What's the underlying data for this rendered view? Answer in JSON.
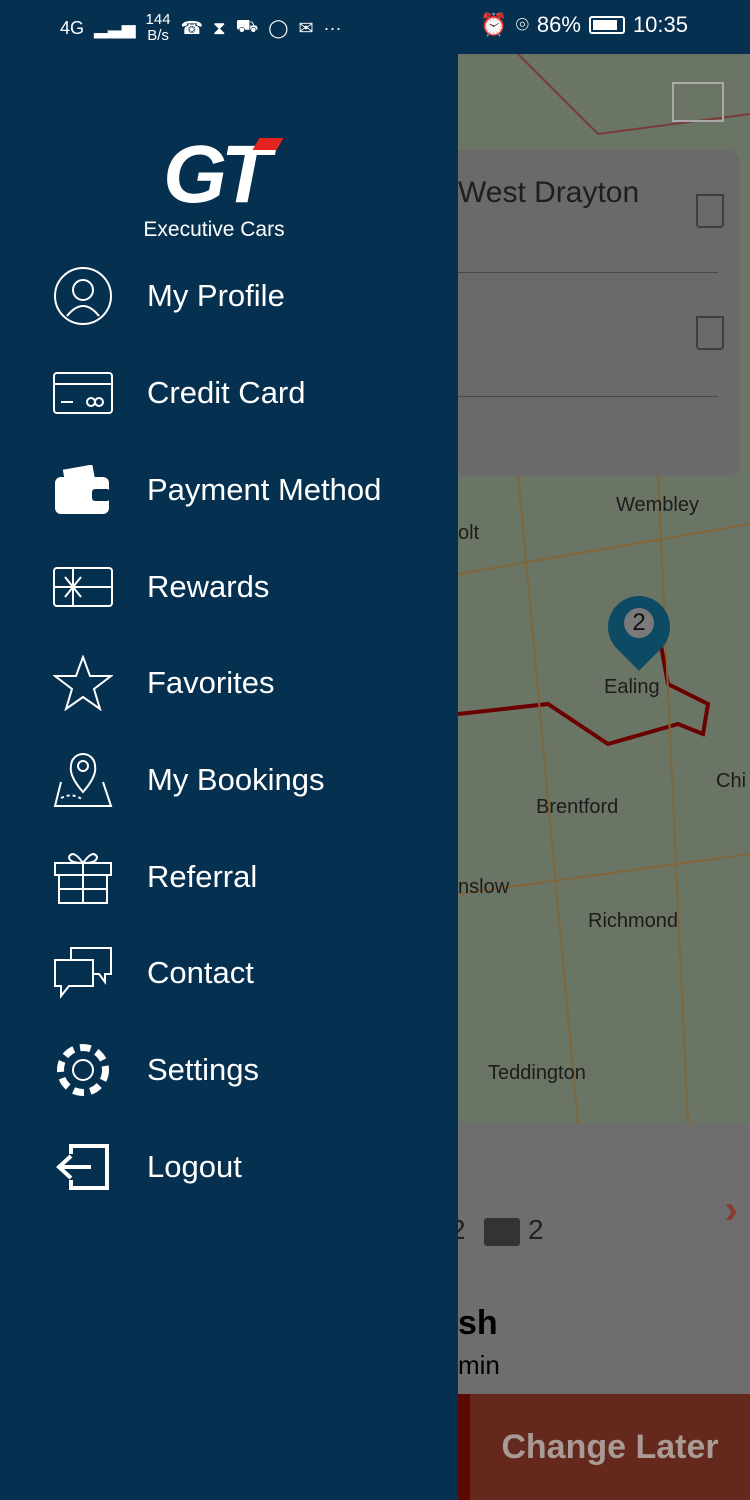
{
  "status_bar": {
    "network": "4G",
    "speed": "144",
    "speed_unit": "B/s",
    "battery": "86%",
    "time": "10:35"
  },
  "logo": {
    "text": "GT",
    "subtitle": "Executive Cars"
  },
  "menu": [
    {
      "label": "My Profile",
      "icon": "user-circle-icon"
    },
    {
      "label": "Credit Card",
      "icon": "credit-card-icon"
    },
    {
      "label": "Payment Method",
      "icon": "wallet-icon"
    },
    {
      "label": "Rewards",
      "icon": "gift-card-icon"
    },
    {
      "label": "Favorites",
      "icon": "star-icon"
    },
    {
      "label": "My Bookings",
      "icon": "map-pin-icon"
    },
    {
      "label": "Referral",
      "icon": "gift-icon"
    },
    {
      "label": "Contact",
      "icon": "chat-icon"
    },
    {
      "label": "Settings",
      "icon": "gear-icon"
    },
    {
      "label": "Logout",
      "icon": "logout-icon"
    }
  ],
  "background": {
    "pickup": "West Drayton",
    "map_labels": [
      "Wembley",
      "olt",
      "Ealing",
      "Brentford",
      "Chi",
      "nslow",
      "Richmond",
      "Teddington"
    ],
    "marker": "2",
    "luggage": "2",
    "passengers": "2",
    "payment": "sh",
    "eta": "min",
    "button": "Change Later"
  },
  "colors": {
    "drawer": "#06304f",
    "accent": "#e52420",
    "button": "#e0401c"
  }
}
